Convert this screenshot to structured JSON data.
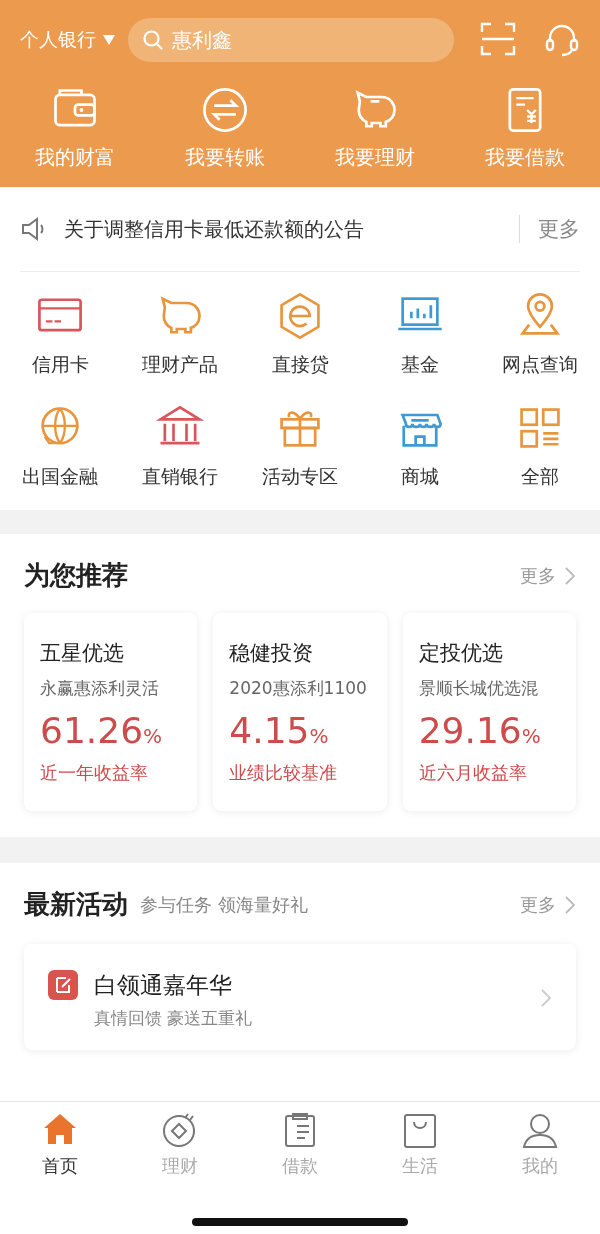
{
  "header": {
    "account": "个人银行",
    "search": {
      "placeholder": "惠利鑫"
    },
    "actions": [
      {
        "label": "我的财富"
      },
      {
        "label": "我要转账"
      },
      {
        "label": "我要理财"
      },
      {
        "label": "我要借款"
      }
    ]
  },
  "notice": {
    "text": "关于调整信用卡最低还款额的公告",
    "more": "更多"
  },
  "services": [
    {
      "label": "信用卡",
      "color": "#d9575b"
    },
    {
      "label": "理财产品",
      "color": "#e8963e"
    },
    {
      "label": "直接贷",
      "color": "#e8963e"
    },
    {
      "label": "基金",
      "color": "#3d9ad6"
    },
    {
      "label": "网点查询",
      "color": "#e8963e"
    },
    {
      "label": "出国金融",
      "color": "#e8963e"
    },
    {
      "label": "直销银行",
      "color": "#d9575b"
    },
    {
      "label": "活动专区",
      "color": "#e8963e"
    },
    {
      "label": "商城",
      "color": "#3d9ad6"
    },
    {
      "label": "全部",
      "color": "#e8963e"
    }
  ],
  "recommend": {
    "title": "为您推荐",
    "more": "更多",
    "cards": [
      {
        "category": "五星优选",
        "product": "永赢惠添利灵活",
        "rate": "61.26",
        "unit": "%",
        "rate_label": "近一年收益率"
      },
      {
        "category": "稳健投资",
        "product": "2020惠添利1100",
        "rate": "4.15",
        "unit": "%",
        "rate_label": "业绩比较基准"
      },
      {
        "category": "定投优选",
        "product": "景顺长城优选混",
        "rate": "29.16",
        "unit": "%",
        "rate_label": "近六月收益率"
      }
    ]
  },
  "activities": {
    "title": "最新活动",
    "subtitle": "参与任务 领海量好礼",
    "more": "更多",
    "items": [
      {
        "title": "白领通嘉年华",
        "description": "真情回馈 豪送五重礼"
      }
    ]
  },
  "tab_bar": [
    {
      "label": "首页",
      "selected": true
    },
    {
      "label": "理财",
      "selected": false
    },
    {
      "label": "借款",
      "selected": false
    },
    {
      "label": "生活",
      "selected": false
    },
    {
      "label": "我的",
      "selected": false
    }
  ]
}
